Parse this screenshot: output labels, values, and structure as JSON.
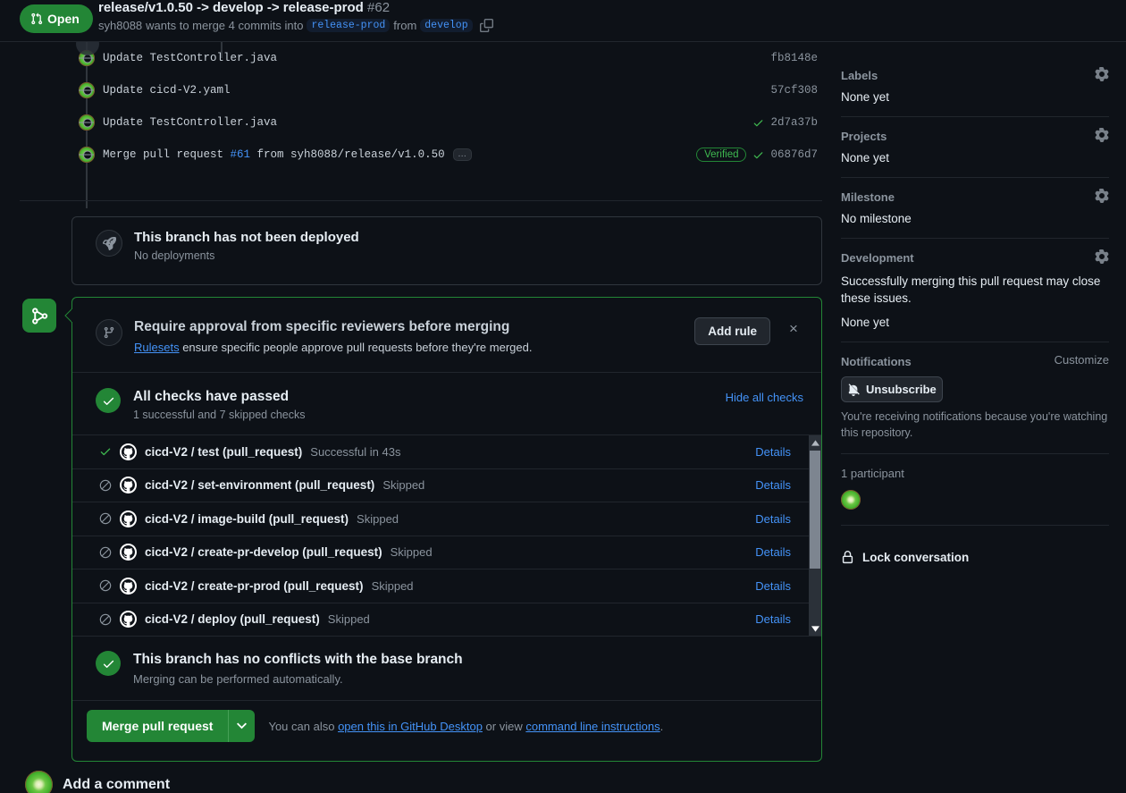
{
  "header": {
    "state_label": "Open",
    "title": "release/v1.0.50 -> develop -> release-prod",
    "number": "#62",
    "sub_author": "syh8088",
    "sub_text": "wants to merge 4 commits into",
    "base_branch": "release-prod",
    "sub_from": "from",
    "head_branch": "develop",
    "copy_icon": "copy-icon"
  },
  "commits": [
    {
      "message": "Update TestController.java",
      "link_text": "",
      "sha": "fb8148e",
      "verified": "",
      "has_check": false,
      "has_dots": false
    },
    {
      "message": "Update cicd-V2.yaml",
      "link_text": "",
      "sha": "57cf308",
      "verified": "",
      "has_check": false,
      "has_dots": false
    },
    {
      "message": "Update TestController.java",
      "link_text": "",
      "sha": "2d7a37b",
      "verified": "",
      "has_check": true,
      "has_dots": false
    },
    {
      "message_pre": "Merge pull request ",
      "link_text": "#61",
      "message_post": " from syh8088/release/v1.0.50",
      "message": "Merge pull request #61 from syh8088/release/v1.0.50",
      "sha": "06876d7",
      "verified": "Verified",
      "has_check": true,
      "has_dots": true,
      "dots_label": "…"
    }
  ],
  "deployment": {
    "icon": "rocket-icon",
    "title": "This branch has not been deployed",
    "subtitle": "No deployments"
  },
  "ruleset": {
    "state_icon": "git-merge-icon",
    "icon": "git-branch-icon",
    "title": "Require approval from specific reviewers before merging",
    "sub_link": "Rulesets",
    "sub_text": " ensure specific people approve pull requests before they're merged.",
    "add_rule_label": "Add rule",
    "close_label": "×"
  },
  "checks": {
    "title": "All checks have passed",
    "subtitle": "1 successful and 7 skipped checks",
    "hide_label": "Hide all checks",
    "details_label": "Details",
    "rows": [
      {
        "status": "success",
        "name": "cicd-V2 / test (pull_request)",
        "result": "Successful in 43s"
      },
      {
        "status": "skipped",
        "name": "cicd-V2 / set-environment (pull_request)",
        "result": "Skipped"
      },
      {
        "status": "skipped",
        "name": "cicd-V2 / image-build (pull_request)",
        "result": "Skipped"
      },
      {
        "status": "skipped",
        "name": "cicd-V2 / create-pr-develop (pull_request)",
        "result": "Skipped"
      },
      {
        "status": "skipped",
        "name": "cicd-V2 / create-pr-prod (pull_request)",
        "result": "Skipped"
      },
      {
        "status": "skipped",
        "name": "cicd-V2 / deploy (pull_request)",
        "result": "Skipped"
      }
    ]
  },
  "conflict": {
    "title": "This branch has no conflicts with the base branch",
    "subtitle": "Merging can be performed automatically."
  },
  "merge": {
    "button_label": "Merge pull request",
    "caret_icon": "chevron-down-icon",
    "note_pre": "You can also ",
    "desktop_link": "open this in GitHub Desktop",
    "note_mid": " or view ",
    "cli_link": "command line instructions",
    "note_post": "."
  },
  "comment": {
    "title": "Add a comment"
  },
  "sidebar": {
    "labels": {
      "heading": "Labels",
      "value": "None yet",
      "gear": "gear-icon"
    },
    "projects": {
      "heading": "Projects",
      "value": "None yet",
      "gear": "gear-icon"
    },
    "milestone": {
      "heading": "Milestone",
      "value": "No milestone",
      "gear": "gear-icon"
    },
    "development": {
      "heading": "Development",
      "paragraph": "Successfully merging this pull request may close these issues.",
      "value": "None yet",
      "gear": "gear-icon"
    },
    "notifications": {
      "heading": "Notifications",
      "customize": "Customize",
      "button_label": "Unsubscribe",
      "button_icon": "bell-slash-icon",
      "note": "You're receiving notifications because you're watching this repository."
    },
    "participants": {
      "heading": "1 participant",
      "avatar": "kiwi-avatar"
    },
    "lock": {
      "icon": "lock-icon",
      "label": "Lock conversation"
    }
  },
  "colors": {
    "bg": "#0d1117",
    "green": "#238636",
    "green_text": "#3fb950",
    "link": "#4493f8",
    "muted": "#8b949e",
    "border": "#30363d"
  }
}
